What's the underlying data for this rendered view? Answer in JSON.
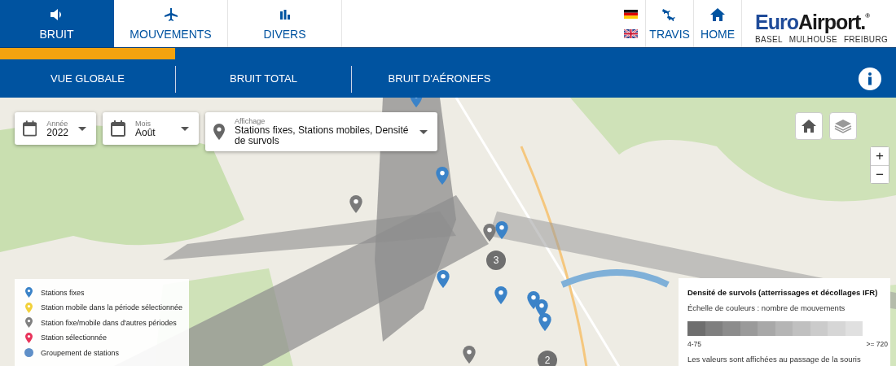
{
  "top_tabs": [
    {
      "label": "BRUIT",
      "kind": "speaker",
      "selected": true
    },
    {
      "label": "MOUVEMENTS",
      "kind": "plane",
      "selected": false
    },
    {
      "label": "DIVERS",
      "kind": "bars",
      "selected": false
    }
  ],
  "nav_links": [
    {
      "label": "TRAVIS",
      "kind": "planes"
    },
    {
      "label": "HOME",
      "kind": "home"
    }
  ],
  "logo": {
    "first": "Euro",
    "second": "Airport.",
    "mark": "®",
    "tagline": [
      "BASEL",
      "MULHOUSE",
      "FREIBURG"
    ]
  },
  "sub_tabs": [
    {
      "label": "VUE GLOBALE",
      "selected": true
    },
    {
      "label": "BRUIT TOTAL",
      "selected": false
    },
    {
      "label": "BRUIT D'AÉRONEFS",
      "selected": false
    }
  ],
  "filters": [
    {
      "label": "Année",
      "value": "2022",
      "kind": "calendar"
    },
    {
      "label": "Mois",
      "value": "Août",
      "kind": "calendar"
    },
    {
      "label": "Affichage",
      "value": "Stations fixes, Stations mobiles, Densité de survols",
      "kind": "pin"
    }
  ],
  "zoom_buttons": [
    "+",
    "−"
  ],
  "markers": [
    {
      "kind": "pin",
      "color": "#3b83c8"
    },
    {
      "kind": "pin",
      "color": "#3b83c8"
    },
    {
      "kind": "pin",
      "color": "#3b83c8"
    },
    {
      "kind": "pin",
      "color": "#3b83c8"
    },
    {
      "kind": "pin",
      "color": "#3b83c8"
    },
    {
      "kind": "pin",
      "color": "#3b83c8"
    },
    {
      "kind": "pin",
      "color": "#3b83c8"
    },
    {
      "kind": "pin",
      "color": "#3b83c8"
    },
    {
      "kind": "pin",
      "color": "#7a7a7a"
    },
    {
      "kind": "pin",
      "color": "#7a7a7a"
    },
    {
      "kind": "pin",
      "color": "#7a7a7a"
    },
    {
      "kind": "cluster",
      "color": "#6f6f6f",
      "count": "3"
    },
    {
      "kind": "cluster",
      "color": "#6f6f6f",
      "count": "2"
    }
  ],
  "legend": [
    {
      "kind": "pin",
      "color": "#3b83c8",
      "label": "Stations fixes"
    },
    {
      "kind": "pin",
      "color": "#f2d13a",
      "label": "Station mobile dans la période sélectionnée"
    },
    {
      "kind": "pin",
      "color": "#808080",
      "label": "Station fixe/mobile dans d'autres périodes"
    },
    {
      "kind": "pin",
      "color": "#e8335a",
      "label": "Station sélectionnée"
    },
    {
      "kind": "cluster",
      "color": "#5f8fc8",
      "label": "Groupement de stations"
    }
  ],
  "density_panel": {
    "title": "Densité de survols (atterrissages et décollages IFR)",
    "subtitle": "Échelle de couleurs : nombre de mouvements",
    "min_label": "4-75",
    "max_label": ">= 720",
    "note": "Les valeurs sont affichées au passage de la souris"
  }
}
